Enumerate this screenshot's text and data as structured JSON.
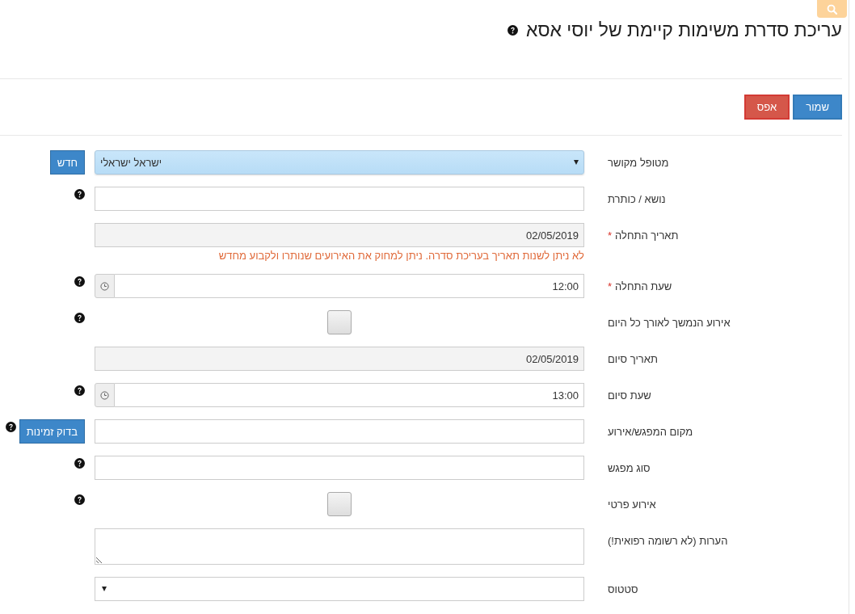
{
  "header": {
    "search_button": {
      "kind": "search"
    },
    "title": "עריכת סדרת משימות קיימת של יוסי אסא",
    "help": true
  },
  "actions": [
    {
      "label": "שמור",
      "kind": "primary"
    },
    {
      "label": "אפס",
      "kind": "danger"
    }
  ],
  "form": [
    {
      "kind": "select",
      "label": "מטופל מקושר",
      "value": "ישראל ישראלי",
      "highlighted": true,
      "button": "חדש"
    },
    {
      "kind": "input",
      "label": "נושא / כותרת",
      "help": true
    },
    {
      "kind": "input",
      "label": "תאריך התחלה",
      "required_mark": "*",
      "value": "02/05/2019",
      "disabled": true,
      "note": "לא ניתן לשנות תאריך בעריכת סדרה. ניתן למחוק את האירועים שנותרו ולקבוע מחדש"
    },
    {
      "kind": "time",
      "label": "שעת התחלה",
      "required_mark": "*",
      "value": "12:00",
      "help": true
    },
    {
      "kind": "checkbox",
      "label": "אירוע הנמשך לאורך כל היום",
      "checked": false,
      "help": true
    },
    {
      "kind": "input",
      "label": "תאריך סיום",
      "value": "02/05/2019",
      "disabled": true
    },
    {
      "kind": "time",
      "label": "שעת סיום",
      "value": "13:00",
      "help": true
    },
    {
      "kind": "input",
      "label": "מקום המפגש/אירוע",
      "help": true,
      "button": "בדוק זמינות"
    },
    {
      "kind": "input",
      "label": "סוג מפגש",
      "help": true
    },
    {
      "kind": "checkbox",
      "label": "אירוע פרטי",
      "checked": false,
      "help": true
    },
    {
      "kind": "textarea",
      "label": "הערות (לא רשומה רפואית!)"
    },
    {
      "kind": "select",
      "label": "סטטוס",
      "highlighted": false
    }
  ]
}
